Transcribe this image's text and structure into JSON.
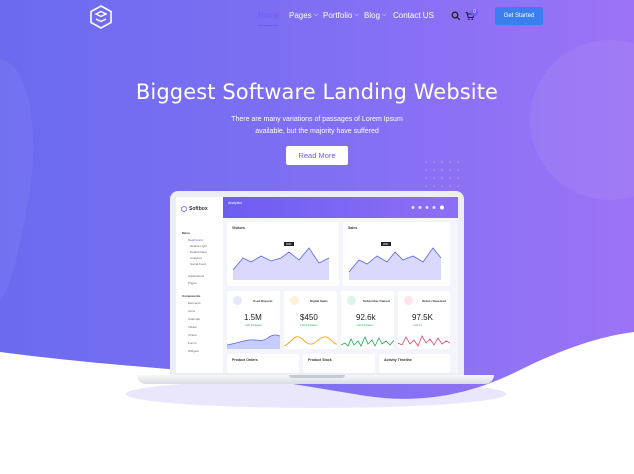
{
  "nav": {
    "items": [
      {
        "label": "Home",
        "active": true
      },
      {
        "label": "Pages",
        "dropdown": true
      },
      {
        "label": "Portfolio",
        "dropdown": true
      },
      {
        "label": "Blog",
        "dropdown": true
      },
      {
        "label": "Contact US",
        "dropdown": false
      }
    ],
    "cart_count": "0",
    "cta_label": "Get Started"
  },
  "hero": {
    "title": "Biggest Software Landing Website",
    "subtitle": "There are many variations of passages of Lorem Ipsum available, but the majority have suffered",
    "button_label": "Read More"
  },
  "dashboard": {
    "brand": "Softbox",
    "header_title": "Analytics",
    "menu_label": "Menu",
    "components_label": "Components",
    "side_items": [
      "Dashboard",
      "Default Light",
      "Default Dark",
      "Analytics",
      "Social Feed",
      "Applications",
      "Pages"
    ],
    "component_items": [
      "Elements",
      "Icons",
      "Calendar",
      "Tables",
      "Charts",
      "Forms",
      "Widgets"
    ],
    "visitors": {
      "title": "Visitors",
      "tag": "2842"
    },
    "sales": {
      "title": "Sales",
      "tag": "2841"
    },
    "stats": [
      {
        "label": "Used Reports",
        "value": "1.5M",
        "change": "+5% Increased",
        "color": "#5b7cf5"
      },
      {
        "label": "Digital Sales",
        "value": "$450",
        "change": "+5% Increased",
        "color": "#f5a623"
      },
      {
        "label": "Subscriber Gained",
        "value": "92.6k",
        "change": "+3% Increased",
        "color": "#22aa55"
      },
      {
        "label": "Orders Received",
        "value": "97.5K",
        "change": "+1% Inc",
        "color": "#e0456b"
      }
    ],
    "bottom_cards": [
      "Product Orders",
      "Product Stock",
      "Activity Timeline"
    ]
  },
  "colors": {
    "accent": "#6f5bf5",
    "cta": "#3b7ef0",
    "hero_from": "#6b66f0",
    "hero_to": "#9a72f6"
  }
}
